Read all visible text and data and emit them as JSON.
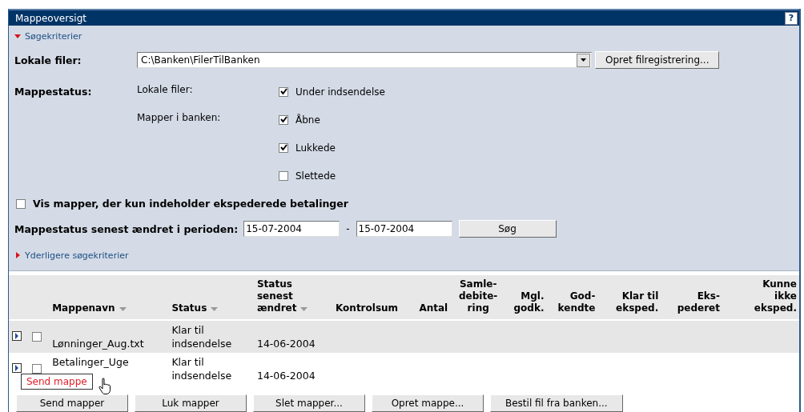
{
  "window": {
    "title": "Mappeoversigt",
    "help": "?"
  },
  "search": {
    "toggle": {
      "label": "Søgekriterier",
      "expanded": true
    },
    "local_files": {
      "label": "Lokale filer:",
      "value": "C:\\Banken\\FilerTilBanken",
      "button": "Opret filregistrering..."
    },
    "folder_status": {
      "label": "Mappestatus:",
      "groups": [
        {
          "label": "Lokale filer:",
          "options": [
            {
              "label": "Under indsendelse",
              "checked": true
            }
          ]
        },
        {
          "label": "Mapper i banken:",
          "options": [
            {
              "label": "Åbne",
              "checked": true
            },
            {
              "label": "Lukkede",
              "checked": true
            },
            {
              "label": "Slettede",
              "checked": false
            }
          ]
        }
      ]
    },
    "only_expedited": {
      "label": "Vis mapper, der kun indeholder ekspederede betalinger",
      "checked": false
    },
    "period": {
      "label": "Mappestatus senest ændret i perioden:",
      "from": "15-07-2004",
      "separator": "-",
      "to": "15-07-2004",
      "button": "Søg"
    },
    "more": {
      "label": "Yderligere søgekriterier",
      "expanded": false
    }
  },
  "table": {
    "columns": [
      {
        "lines": [
          "Mappenavn"
        ],
        "sortable": true
      },
      {
        "lines": [
          "Status"
        ],
        "sortable": true
      },
      {
        "lines": [
          "Status",
          "senest",
          "ændret"
        ],
        "sortable": true
      },
      {
        "lines": [
          "Kontrolsum"
        ],
        "sortable": false
      },
      {
        "lines": [
          "Antal"
        ],
        "sortable": false
      },
      {
        "lines": [
          "Samle-",
          "debite-",
          "ring"
        ],
        "sortable": false
      },
      {
        "lines": [
          "Mgl.",
          "godk."
        ],
        "sortable": false
      },
      {
        "lines": [
          "God-",
          "kendte"
        ],
        "sortable": false
      },
      {
        "lines": [
          "Klar til",
          "eksped."
        ],
        "sortable": false
      },
      {
        "lines": [
          "Eks-",
          "pederet"
        ],
        "sortable": false
      },
      {
        "lines": [
          "Kunne",
          "ikke",
          "eksped."
        ],
        "sortable": false
      }
    ],
    "rows": [
      {
        "checked": false,
        "name": "Lønninger_Aug.txt",
        "status": "Klar til indsendelse",
        "changed": "14-06-2004"
      },
      {
        "checked": false,
        "name": "Betalinger_Uge",
        "status": "Klar til indsendelse",
        "changed": "14-06-2004"
      }
    ]
  },
  "tooltip": "Send mappe",
  "buttons": [
    "Send mapper",
    "Luk mapper",
    "Slet mapper...",
    "Opret mappe...",
    "Bestil fil fra banken..."
  ]
}
